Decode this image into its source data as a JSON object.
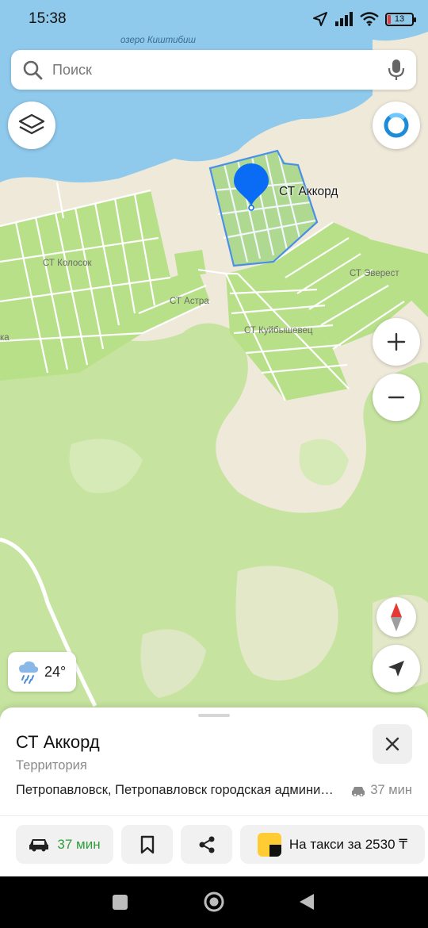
{
  "status_bar": {
    "time": "15:38",
    "battery": "13"
  },
  "search": {
    "placeholder": "Поиск"
  },
  "map": {
    "labels": {
      "lake": "озеро Киштибиш",
      "kolosok": "СТ Колосок",
      "astra": "СТ Астра",
      "everest": "СТ Эверест",
      "kuibyshevets": "СТ Куйбышевец",
      "partial_left": "ка"
    },
    "selected_poi": "СТ Аккорд",
    "colors": {
      "land": "#efe9da",
      "water": "#8fc9ec",
      "forest": "#c6e4a0",
      "gardens": "#b8e089",
      "selection": "#4a90e2",
      "pin": "#0a6cf5"
    }
  },
  "weather": {
    "temperature": "24°",
    "icon": "rain-cloud-icon"
  },
  "place_card": {
    "title": "СТ Аккорд",
    "type": "Территория",
    "address": "Петропавловск, Петропавловск городская администрация",
    "eta": "37 мин"
  },
  "actions": {
    "route_label": "37 мин",
    "taxi_label": "На такси за 2530 ₸"
  }
}
